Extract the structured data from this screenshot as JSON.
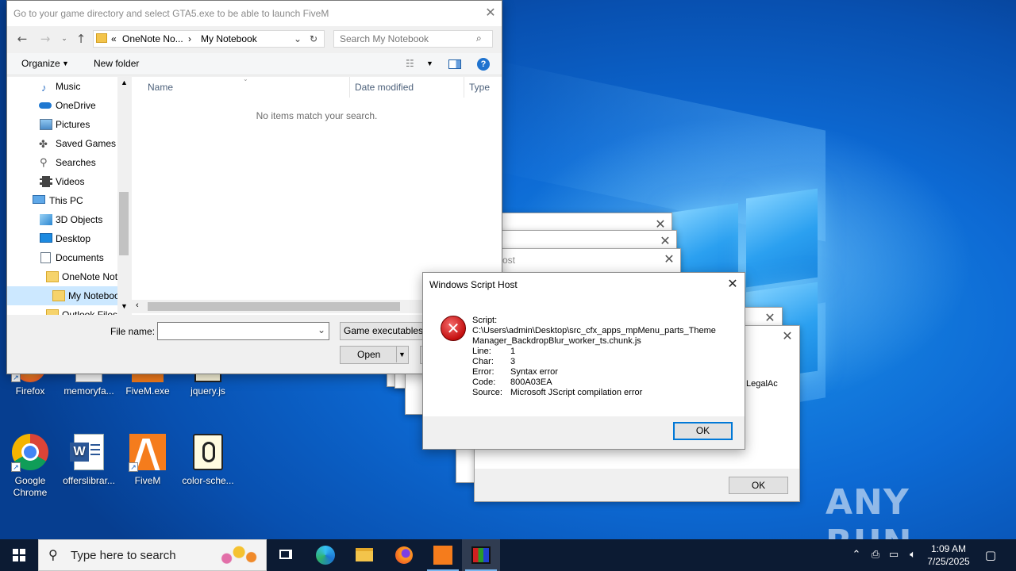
{
  "file_dialog": {
    "title": "Go to your game directory and select GTA5.exe to be able to launch FiveM",
    "address_prefix": "«",
    "address_crumb_1": "OneNote No...",
    "address_crumb_2": "My Notebook",
    "search_placeholder": "Search My Notebook",
    "organize_label": "Organize",
    "new_folder_label": "New folder",
    "nav_items": [
      {
        "label": "Music",
        "icon": "music-icon"
      },
      {
        "label": "OneDrive",
        "icon": "cloud-icon"
      },
      {
        "label": "Pictures",
        "icon": "pictures-icon"
      },
      {
        "label": "Saved Games",
        "icon": "gamepad-icon"
      },
      {
        "label": "Searches",
        "icon": "search-icon"
      },
      {
        "label": "Videos",
        "icon": "video-icon"
      },
      {
        "label": "This PC",
        "icon": "computer-icon"
      },
      {
        "label": "3D Objects",
        "icon": "cube-icon"
      },
      {
        "label": "Desktop",
        "icon": "desktop-icon"
      },
      {
        "label": "Documents",
        "icon": "documents-icon"
      },
      {
        "label": "OneNote Not",
        "icon": "folder-icon"
      },
      {
        "label": "My Noteboo",
        "icon": "folder-icon"
      },
      {
        "label": "Outlook Files",
        "icon": "folder-icon"
      }
    ],
    "columns": [
      "Name",
      "Date modified",
      "Type"
    ],
    "empty_message": "No items match your search.",
    "file_name_label": "File name:",
    "file_name_value": "",
    "filter_label": "Game executables (",
    "open_label": "Open"
  },
  "wsh_dialog": {
    "title": "Windows Script Host",
    "script_label": "Script:",
    "script_path_1": "C:\\Users\\admin\\Desktop\\src_cfx_apps_mpMenu_parts_Theme",
    "script_path_2": "Manager_BackdropBlur_worker_ts.chunk.js",
    "fields": [
      {
        "k": "Line:",
        "v": "1"
      },
      {
        "k": "Char:",
        "v": "3"
      },
      {
        "k": "Error:",
        "v": "Syntax error"
      },
      {
        "k": "Code:",
        "v": "800A03EA"
      },
      {
        "k": "Source:",
        "v": "Microsoft JScript compilation error"
      }
    ],
    "ok_label": "OK"
  },
  "back_windows": {
    "partial_title": "ost",
    "partial_text": "LegalAc",
    "ok_label": "OK"
  },
  "desktop_icons": [
    {
      "label": "Firefox"
    },
    {
      "label": "memoryfa..."
    },
    {
      "label": "FiveM.exe"
    },
    {
      "label": "jquery.js"
    },
    {
      "label": "Google Chrome"
    },
    {
      "label": "offerslibrar..."
    },
    {
      "label": "FiveM"
    },
    {
      "label": "color-sche..."
    }
  ],
  "taskbar": {
    "search_placeholder": "Type here to search",
    "time": "1:09 AM",
    "date": "7/25/2025"
  },
  "watermark": "ANY RUN",
  "colors": {
    "accent": "#0078d7",
    "taskbar": "#0c1b33",
    "error_red": "#c41010"
  }
}
